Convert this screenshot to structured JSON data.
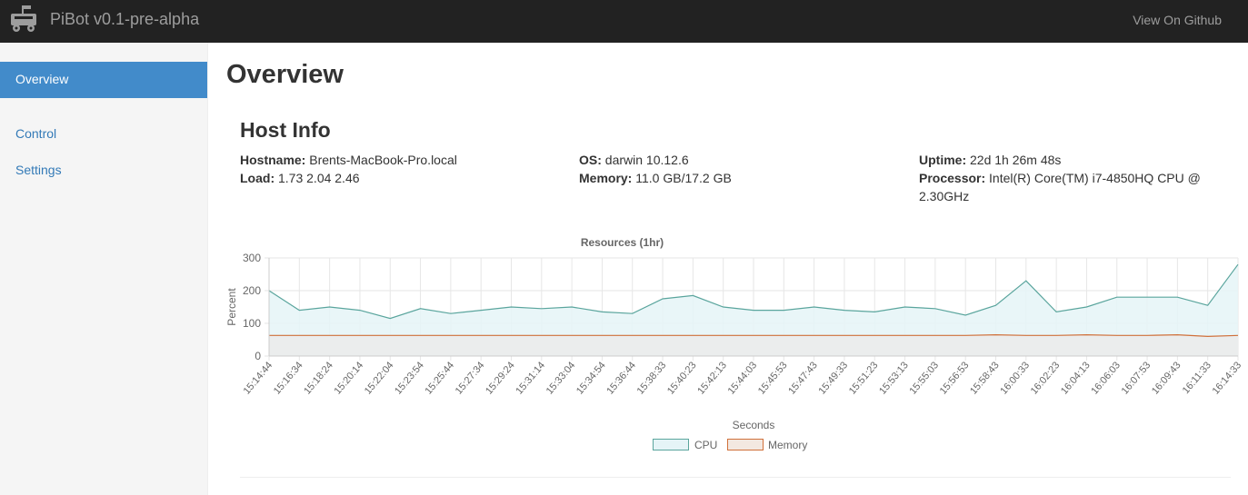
{
  "app": {
    "title": "PiBot v0.1-pre-alpha",
    "github_link": "View On Github"
  },
  "sidebar": {
    "items": [
      {
        "label": "Overview",
        "active": true
      },
      {
        "label": "Control"
      },
      {
        "label": "Settings"
      }
    ]
  },
  "page": {
    "title": "Overview"
  },
  "host": {
    "title": "Host Info",
    "hostname_label": "Hostname:",
    "hostname": "Brents-MacBook-Pro.local",
    "load_label": "Load:",
    "load": "1.73 2.04 2.46",
    "os_label": "OS:",
    "os": "darwin 10.12.6",
    "memory_label": "Memory:",
    "memory": "11.0 GB/17.2 GB",
    "uptime_label": "Uptime:",
    "uptime": "22d 1h 26m 48s",
    "processor_label": "Processor:",
    "processor": "Intel(R) Core(TM) i7-4850HQ CPU @ 2.30GHz"
  },
  "colors": {
    "topbar": "#222222",
    "active_nav": "#428bca",
    "link": "#337ab7",
    "cpu_line": "#5aa59d",
    "cpu_fill": "#e5f4f7",
    "mem_line": "#d0703a",
    "mem_fill": "#ebebeb"
  },
  "chart_data": {
    "type": "area",
    "title": "Resources (1hr)",
    "xlabel": "Seconds",
    "ylabel": "Percent",
    "ylim": [
      0,
      300
    ],
    "yticks": [
      0,
      100,
      200,
      300
    ],
    "grid": true,
    "legend_placement": "bottom",
    "x": [
      "15:14:44",
      "15:16:34",
      "15:18:24",
      "15:20:14",
      "15:22:04",
      "15:23:54",
      "15:25:44",
      "15:27:34",
      "15:29:24",
      "15:31:14",
      "15:33:04",
      "15:34:54",
      "15:36:44",
      "15:38:33",
      "15:40:23",
      "15:42:13",
      "15:44:03",
      "15:45:53",
      "15:47:43",
      "15:49:33",
      "15:51:23",
      "15:53:13",
      "15:55:03",
      "15:56:53",
      "15:58:43",
      "16:00:33",
      "16:02:23",
      "16:04:13",
      "16:06:03",
      "16:07:53",
      "16:09:43",
      "16:11:33",
      "16:14:33"
    ],
    "series": [
      {
        "name": "CPU",
        "values": [
          200,
          140,
          150,
          140,
          115,
          145,
          130,
          140,
          150,
          145,
          150,
          135,
          130,
          175,
          185,
          150,
          140,
          140,
          150,
          140,
          135,
          150,
          145,
          125,
          155,
          230,
          135,
          150,
          180,
          180,
          180,
          155,
          280
        ]
      },
      {
        "name": "Memory",
        "values": [
          63,
          63,
          63,
          63,
          63,
          63,
          63,
          63,
          63,
          63,
          63,
          63,
          63,
          63,
          63,
          63,
          63,
          63,
          63,
          63,
          63,
          63,
          63,
          63,
          65,
          63,
          63,
          65,
          63,
          63,
          65,
          60,
          63
        ]
      }
    ]
  }
}
